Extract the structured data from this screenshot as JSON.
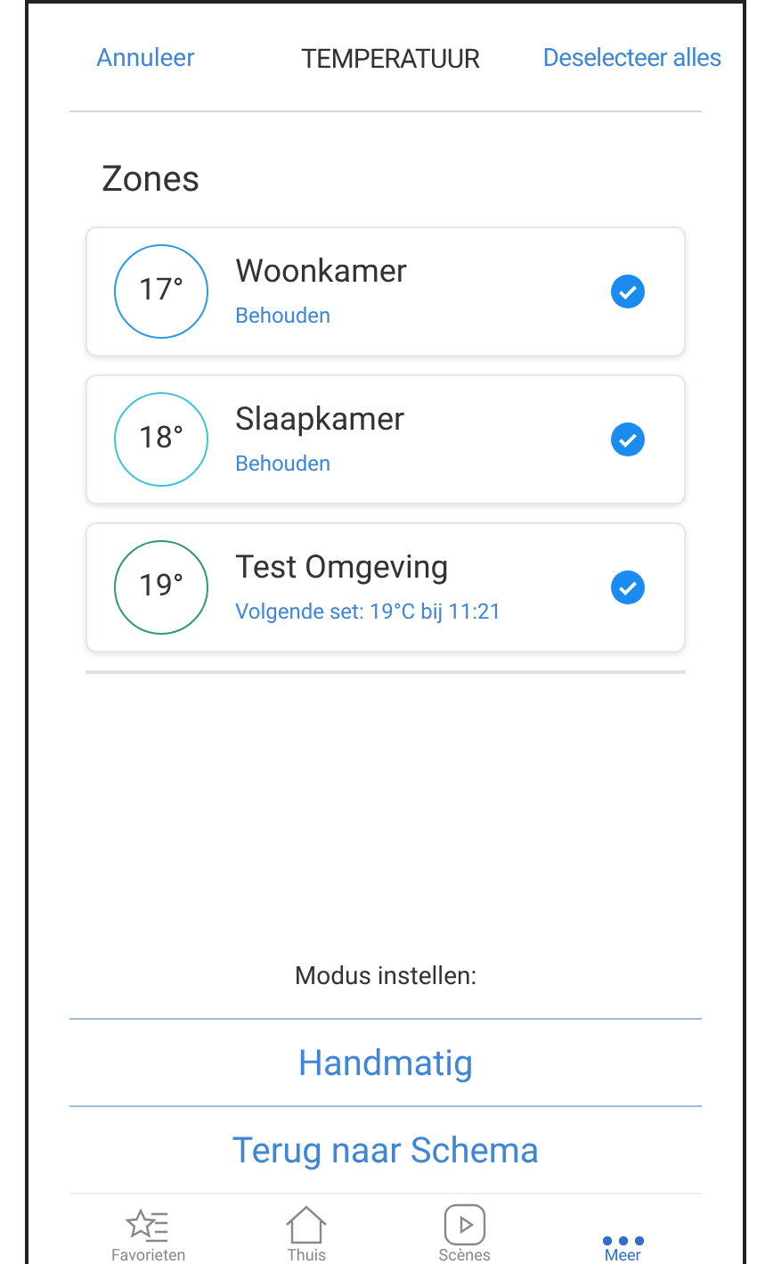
{
  "header": {
    "cancel": "Annuleer",
    "title": "TEMPERATUUR",
    "deselect_all": "Deselecteer alles"
  },
  "section_title": "Zones",
  "zones": [
    {
      "temperature": "17°",
      "name": "Woonkamer",
      "status": "Behouden",
      "color": "#2b9ae6",
      "checked": true
    },
    {
      "temperature": "18°",
      "name": "Slaapkamer",
      "status": "Behouden",
      "color": "#3cc6d6",
      "checked": true
    },
    {
      "temperature": "19°",
      "name": "Test Omgeving",
      "status": "Volgende set: 19°C bij 11:21",
      "color": "#2a9a78",
      "checked": true
    }
  ],
  "mode": {
    "label": "Modus instellen:",
    "options": [
      "Handmatig",
      "Terug naar Schema"
    ]
  },
  "tabs": [
    {
      "kind": "favorites",
      "label": "Favorieten",
      "selected": false
    },
    {
      "kind": "home",
      "label": "Thuis",
      "selected": false
    },
    {
      "kind": "scenes",
      "label": "Scènes",
      "selected": false
    },
    {
      "kind": "more",
      "label": "Meer",
      "selected": true
    }
  ]
}
